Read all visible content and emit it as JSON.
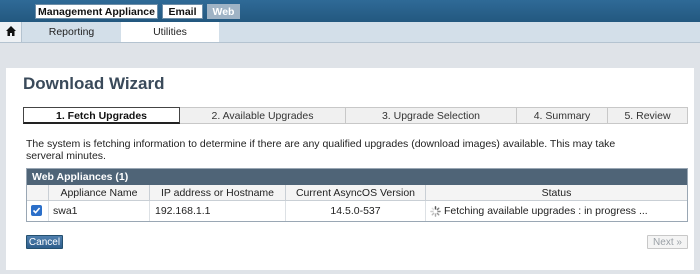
{
  "product_tabs": [
    {
      "label": "Management Appliance"
    },
    {
      "label": "Email"
    },
    {
      "label": "Web"
    }
  ],
  "nav": {
    "items": [
      {
        "label": "Reporting"
      },
      {
        "label": "Utilities"
      }
    ]
  },
  "page": {
    "title": "Download Wizard",
    "steps": [
      {
        "label": "1. Fetch Upgrades"
      },
      {
        "label": "2. Available Upgrades"
      },
      {
        "label": "3. Upgrade Selection"
      },
      {
        "label": "4. Summary"
      },
      {
        "label": "5. Review"
      }
    ],
    "info": "The system is fetching information to determine if there are any qualified upgrades (download images) available. This may take serveral minutes."
  },
  "table": {
    "title": "Web Appliances (1)",
    "headers": [
      "Appliance Name",
      "IP address or Hostname",
      "Current AsyncOS Version",
      "Status"
    ],
    "rows": [
      {
        "checked": true,
        "name": "swa1",
        "ip": "192.168.1.1",
        "version": "14.5.0-537",
        "status": "Fetching available upgrades : in progress ..."
      }
    ]
  },
  "buttons": {
    "cancel": "Cancel",
    "next": "Next »"
  },
  "colors": {
    "topbar": "#23587f",
    "table_header": "#4f6477",
    "checkbox": "#2b6fc9",
    "cancel_button": "#2e5e8c"
  }
}
